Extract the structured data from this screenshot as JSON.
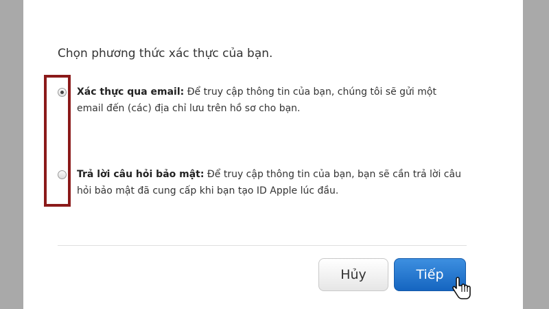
{
  "prompt": "Chọn phương thức xác thực của bạn.",
  "options": [
    {
      "title": "Xác thực qua email:",
      "description": " Để truy cập thông tin của bạn, chúng tôi sẽ gửi một email đến (các) địa chỉ lưu trên hồ sơ cho bạn.",
      "selected": true
    },
    {
      "title": "Trả lời câu hỏi bảo mật:",
      "description": " Để truy cập thông tin của bạn, bạn sẽ cần trả lời câu hỏi bảo mật đã cung cấp khi bạn tạo ID Apple lúc đầu.",
      "selected": false
    }
  ],
  "buttons": {
    "cancel_label": "Hủy",
    "next_label": "Tiếp"
  },
  "colors": {
    "highlight_box": "#8b1a1a",
    "primary_button": "#1565c0"
  },
  "icons": {
    "cursor": "hand-pointer-icon"
  }
}
